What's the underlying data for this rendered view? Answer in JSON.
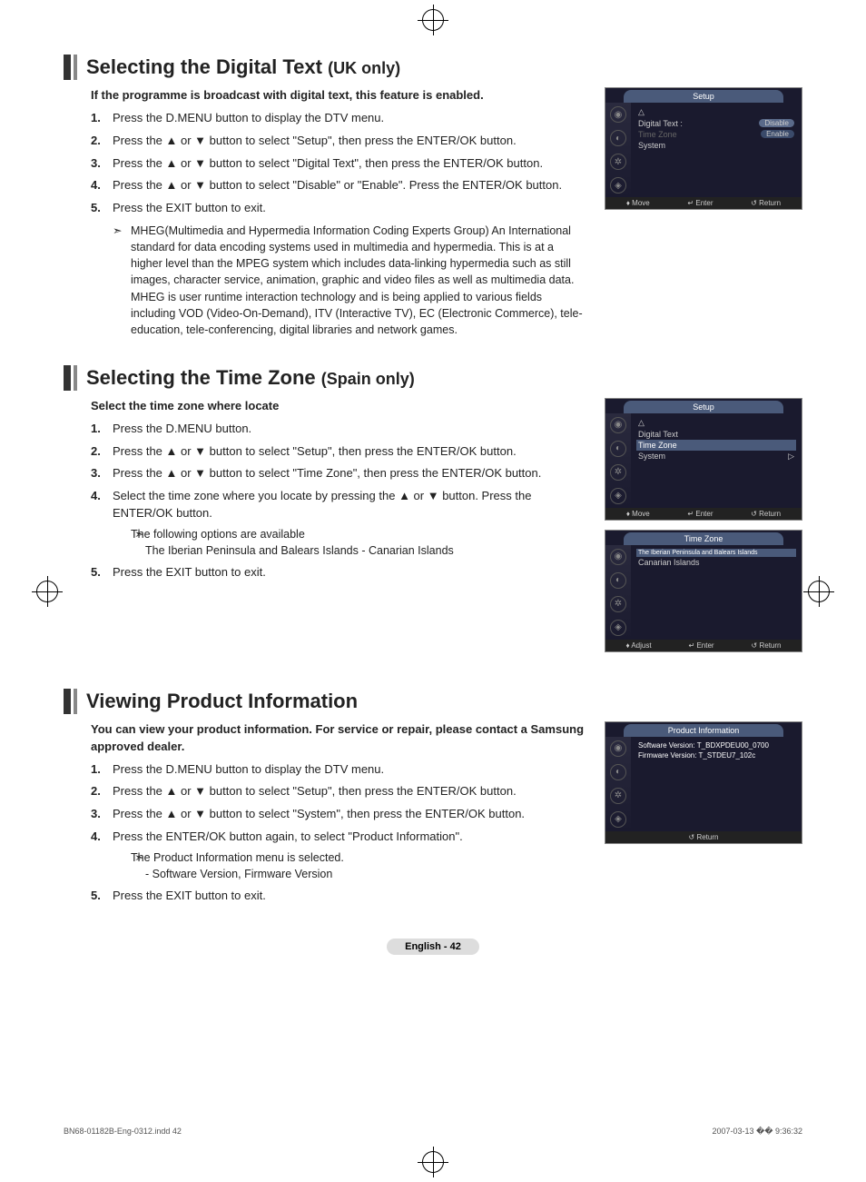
{
  "sections": {
    "digitalText": {
      "title": "Selecting the Digital Text",
      "titleSuffix": "(UK only)",
      "intro": "If the programme is broadcast with digital text, this feature is enabled.",
      "steps": [
        "Press the D.MENU button to display the DTV menu.",
        "Press the ▲ or ▼ button to select \"Setup\", then press the ENTER/OK button.",
        "Press the ▲ or ▼ button to select \"Digital Text\", then press the ENTER/OK button.",
        "Press the ▲ or ▼ button to select \"Disable\" or \"Enable\". Press the ENTER/OK button.",
        "Press the EXIT button to exit."
      ],
      "note": "MHEG(Multimedia and Hypermedia Information Coding Experts Group) An International standard for data encoding systems used in multimedia and hypermedia. This is at a higher level than the MPEG system which includes data-linking hypermedia such as still images, character service, animation, graphic and video files as well as multimedia data. MHEG is user runtime interaction technology and is being applied to various fields including VOD (Video-On-Demand), ITV (Interactive TV), EC (Electronic Commerce), tele-education, tele-conferencing, digital libraries and network games."
    },
    "timeZone": {
      "title": "Selecting the Time Zone",
      "titleSuffix": "(Spain only)",
      "intro": "Select the time zone where locate",
      "steps": [
        "Press the D.MENU button.",
        "Press the ▲ or ▼ button to select \"Setup\", then press the ENTER/OK button.",
        "Press the ▲ or ▼ button to select \"Time Zone\", then press the ENTER/OK button.",
        "Select the time zone where you locate by pressing the ▲ or ▼ button. Press the ENTER/OK button.",
        "Press the EXIT button to exit."
      ],
      "step4note": "The following options are available",
      "step4sub": "The Iberian Peninsula and Balears Islands - Canarian Islands"
    },
    "productInfo": {
      "title": "Viewing Product Information",
      "intro": "You can view your product information. For service or repair, please contact a Samsung approved dealer.",
      "steps": [
        "Press the D.MENU button to display the DTV menu.",
        "Press the ▲ or ▼ button to select \"Setup\", then press the ENTER/OK button.",
        "Press the ▲ or ▼ button to select \"System\", then press the ENTER/OK button.",
        "Press the ENTER/OK button again, to select \"Product Information\".",
        "Press the EXIT button to exit."
      ],
      "step4note": "The Product Information menu is selected.",
      "step4sub": "- Software Version, Firmware Version"
    }
  },
  "osd": {
    "setup1": {
      "title": "Setup",
      "rows": {
        "digitalText": "Digital Text :",
        "timeZone": "Time Zone",
        "system": "System"
      },
      "values": {
        "disable": "Disable",
        "enable": "Enable"
      },
      "footer": {
        "move": "Move",
        "enter": "Enter",
        "return": "Return"
      }
    },
    "setup2": {
      "title": "Setup",
      "rows": {
        "digitalText": "Digital Text",
        "timeZone": "Time Zone",
        "system": "System"
      },
      "tri": "▷",
      "footer": {
        "move": "Move",
        "enter": "Enter",
        "return": "Return"
      }
    },
    "timeZone": {
      "title": "Time Zone",
      "opt1": "The Iberian Peninsula and Balears Islands",
      "opt2": "Canarian Islands",
      "footer": {
        "adjust": "Adjust",
        "enter": "Enter",
        "return": "Return"
      }
    },
    "productInfo": {
      "title": "Product Information",
      "sw": "Software Version: T_BDXPDEU00_0700",
      "fw": "Firmware Version: T_STDEU7_102c",
      "footer": {
        "return": "Return"
      }
    },
    "triangle": "△",
    "footerIcons": {
      "move": "♦",
      "enter": "↵",
      "return": "↺"
    }
  },
  "pageLabel": "English - 42",
  "footer": {
    "file": "BN68-01182B-Eng-0312.indd   42",
    "date": "2007-03-13   �� 9:36:32"
  }
}
